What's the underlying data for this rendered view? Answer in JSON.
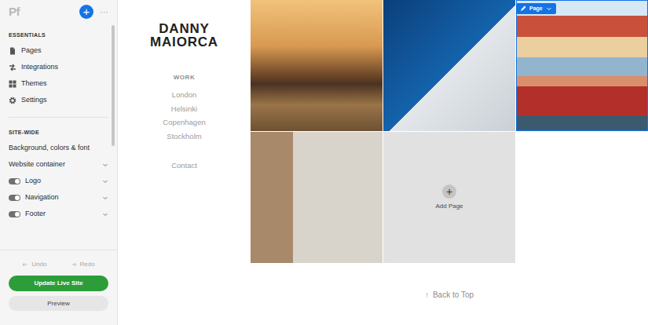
{
  "sidebar": {
    "logo": "Pf",
    "add": "+",
    "more": "···",
    "sections": [
      {
        "title": "ESSENTIALS",
        "items": [
          {
            "label": "Pages",
            "kind": "link"
          },
          {
            "label": "Integrations",
            "kind": "link"
          },
          {
            "label": "Themes",
            "kind": "link"
          },
          {
            "label": "Settings",
            "kind": "link"
          }
        ]
      },
      {
        "title": "SITE-WIDE",
        "items": [
          {
            "label": "Background, colors & font",
            "kind": "plain"
          },
          {
            "label": "Website container",
            "kind": "expand"
          },
          {
            "label": "Logo",
            "kind": "toggle",
            "on": true
          },
          {
            "label": "Navigation",
            "kind": "toggle",
            "on": true
          },
          {
            "label": "Footer",
            "kind": "toggle",
            "on": true
          }
        ]
      }
    ],
    "undo": {
      "label": "Undo",
      "disabled": true
    },
    "redo": {
      "label": "Redo",
      "disabled": true
    },
    "update_button": "Update Live Site",
    "preview_button": "Preview"
  },
  "site": {
    "title": "DANNY MAIORCA",
    "nav_heading": "WORK",
    "nav_items": [
      "London",
      "Helsinki",
      "Copenhagen",
      "Stockholm"
    ],
    "contact": "Contact",
    "tiles": [
      {
        "selected": false
      },
      {
        "selected": false
      },
      {
        "selected": true
      },
      {
        "selected": false
      }
    ],
    "edit_badge": "Page",
    "add_page": {
      "icon": "+",
      "label": "Add Page"
    },
    "back_to_top": {
      "icon": "↑",
      "label": "Back to Top"
    }
  }
}
